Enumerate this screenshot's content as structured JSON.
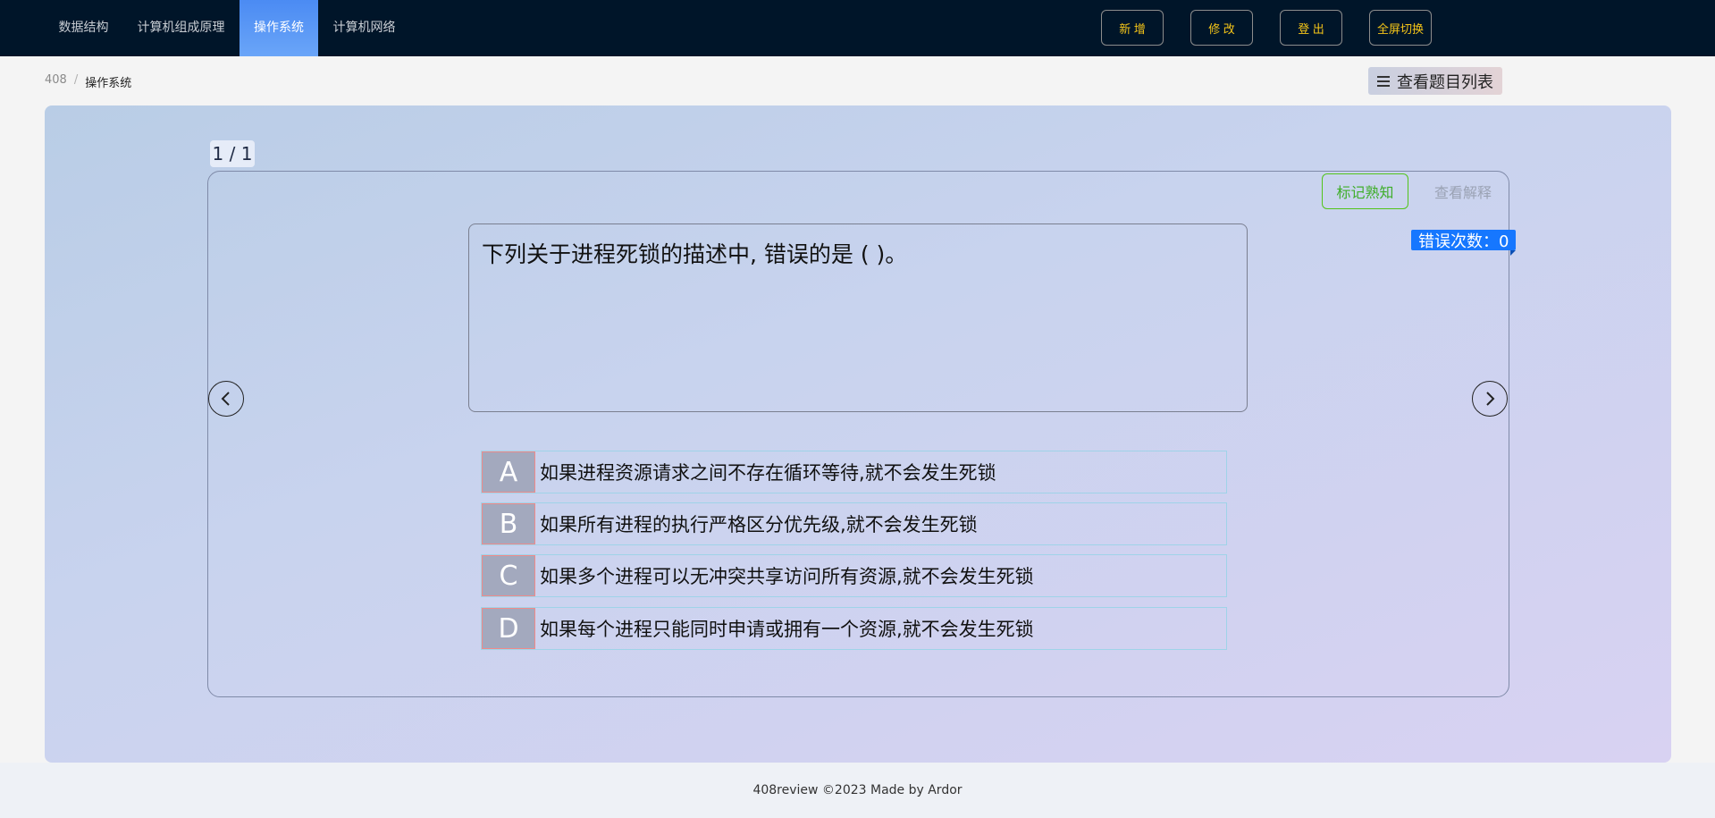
{
  "nav": {
    "tabs": [
      {
        "label": "数据结构"
      },
      {
        "label": "计算机组成原理"
      },
      {
        "label": "操作系统"
      },
      {
        "label": "计算机网络"
      }
    ],
    "active_tab": "操作系统",
    "buttons": {
      "add": "新 增",
      "edit": "修 改",
      "logout": "登 出",
      "fullscreen": "全屏切换"
    }
  },
  "breadcrumb": {
    "root": "408",
    "separator": "/",
    "current": "操作系统"
  },
  "list_button": {
    "icon": "list-icon",
    "label": "查看题目列表"
  },
  "quiz": {
    "counter": "1 / 1",
    "mark_label": "标记熟知",
    "explain_label": "查看解释",
    "error_count_label": "错误次数：0",
    "question": "下列关于进程死锁的描述中, 错误的是 ( )。",
    "options": [
      {
        "letter": "A",
        "text": "如果进程资源请求之间不存在循环等待,就不会发生死锁"
      },
      {
        "letter": "B",
        "text": "如果所有进程的执行严格区分优先级,就不会发生死锁"
      },
      {
        "letter": "C",
        "text": "如果多个进程可以无冲突共享访问所有资源,就不会发生死锁"
      },
      {
        "letter": "D",
        "text": "如果每个进程只能同时申请或拥有一个资源,就不会发生死锁"
      }
    ],
    "prev_icon": "chevron-left-icon",
    "next_icon": "chevron-right-icon"
  },
  "footer": {
    "text": "408review ©2023 Made by Ardor"
  },
  "colors": {
    "topbar": "#001529",
    "active_tab": "#4b8bf3",
    "button_text": "#f5c518",
    "mark_green": "#52c41a",
    "error_badge": "#1677ff"
  }
}
